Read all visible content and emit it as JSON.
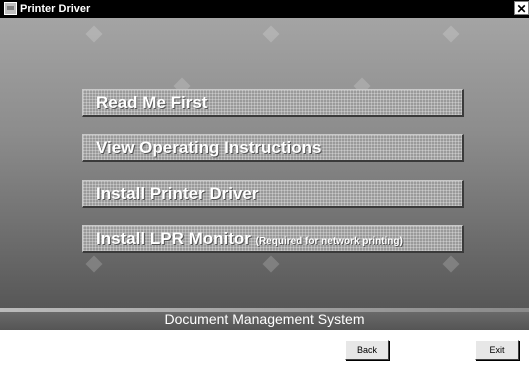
{
  "window": {
    "title": "Printer Driver",
    "close_label": "✕"
  },
  "menu": {
    "items": [
      {
        "label": "Read Me First",
        "note": ""
      },
      {
        "label": "View Operating Instructions",
        "note": ""
      },
      {
        "label": "Install Printer Driver",
        "note": ""
      },
      {
        "label": "Install LPR Monitor",
        "note": "(Required for network printing)"
      }
    ]
  },
  "footer": {
    "label": "Document Management System"
  },
  "buttons": {
    "back_label": "Back",
    "exit_label": "Exit"
  }
}
